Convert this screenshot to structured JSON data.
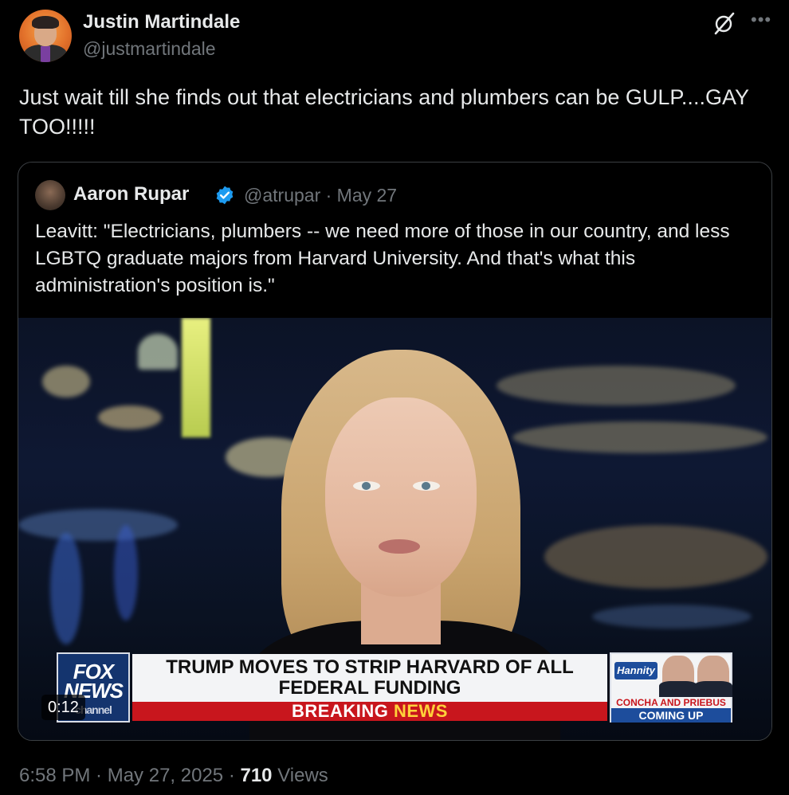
{
  "author": {
    "name": "Justin Martindale",
    "handle": "@justmartindale"
  },
  "tweet": {
    "text": "Just wait till she finds out that electricians and plumbers can be GULP....GAY TOO!!!!!"
  },
  "quoted": {
    "name": "Aaron Rupar",
    "handle_date": "@atrupar · May 27",
    "text": "Leavitt: \"Electricians, plumbers -- we need more of those in our country, and less LGBTQ graduate majors from Harvard University. And that's what this administration's position is.\"",
    "video": {
      "timestamp": "0:12",
      "headline": "TRUMP MOVES TO STRIP HARVARD OF ALL FEDERAL FUNDING",
      "breaking_prefix": "BREAKING",
      "breaking_suffix": "NEWS",
      "network_logo_top": "FOX",
      "network_logo_bottom": "NEWS",
      "network_logo_small": "channel",
      "show_logo": "Hannity",
      "guests_line": "CONCHA AND PRIEBUS",
      "coming_up": "COMING UP"
    }
  },
  "meta": {
    "time": "6:58 PM",
    "separator": " · ",
    "date": "May 27, 2025",
    "views_count": "710",
    "views_label": " Views"
  },
  "icons": {
    "grok": "grok-icon",
    "more": "more-icon",
    "verified": "verified-icon"
  },
  "colors": {
    "background": "#000000",
    "text": "#e7e9ea",
    "secondary": "#71767b",
    "verified": "#1d9bf0",
    "fox_red": "#c8161d",
    "fox_blue": "#14346e"
  }
}
